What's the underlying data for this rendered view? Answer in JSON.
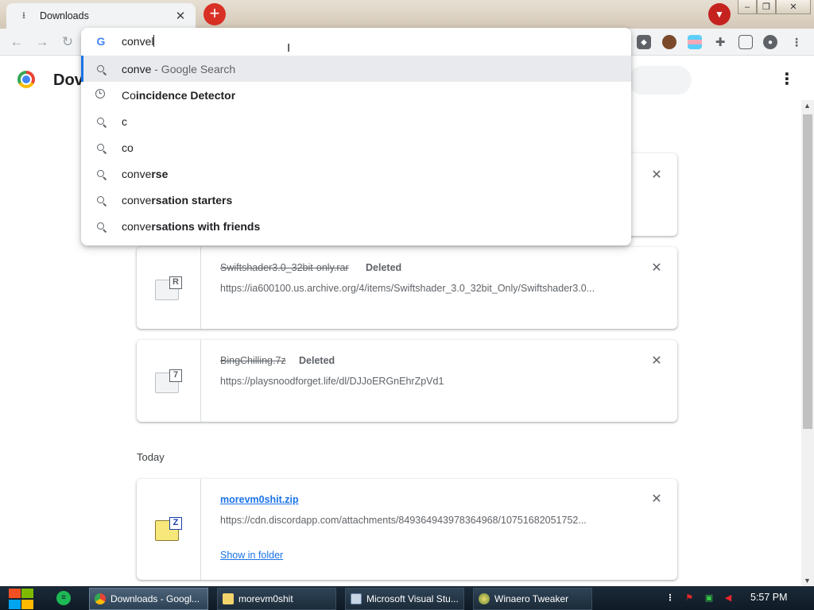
{
  "tab": {
    "title": "Downloads",
    "close_glyph": "✕",
    "icon": "download-icon"
  },
  "window_controls": {
    "minimize": "–",
    "maximize": "❐",
    "close": "✕"
  },
  "omnibox": {
    "input": "convel",
    "suggestions": [
      {
        "icon": "search-icon",
        "bold_prefix": "",
        "text": "conve",
        "suffix": " - Google Search",
        "selected": true
      },
      {
        "icon": "history-icon",
        "bold_prefix": "Co",
        "text": "incidence Detector",
        "suffix": "",
        "selected": false
      },
      {
        "icon": "search-icon",
        "bold_prefix": "",
        "text": "c",
        "suffix": "",
        "selected": false
      },
      {
        "icon": "search-icon",
        "bold_prefix": "",
        "text": "co",
        "suffix": "",
        "selected": false
      },
      {
        "icon": "search-icon",
        "bold_prefix": "conve",
        "text": "rse",
        "suffix": "",
        "selected": false
      },
      {
        "icon": "search-icon",
        "bold_prefix": "conve",
        "text": "rsation starters",
        "suffix": "",
        "selected": false
      },
      {
        "icon": "search-icon",
        "bold_prefix": "conve",
        "text": "rsations with friends",
        "suffix": "",
        "selected": false
      }
    ]
  },
  "page": {
    "title": "Dov",
    "section_today": "Today"
  },
  "downloads": [
    {
      "name": "Swiftshader3.0_32bit-only.rar",
      "status": "Deleted",
      "url": "https://ia600100.us.archive.org/4/items/Swiftshader_3.0_32bit_Only/Swiftshader3.0...",
      "badge": "R"
    },
    {
      "name": "BingChilling.7z",
      "status": "Deleted",
      "url": "https://playsnoodforget.life/dl/DJJoERGnEhrZpVd1",
      "badge": "7"
    },
    {
      "name": "morevm0shit.zip",
      "status": "",
      "url": "https://cdn.discordapp.com/attachments/849364943978364968/10751682051752...",
      "badge": "Z",
      "action": "Show in folder"
    }
  ],
  "taskbar": {
    "items": [
      {
        "label": "Downloads - Googl...",
        "icon": "chrome-icon",
        "active": true
      },
      {
        "label": "morevm0shit",
        "icon": "folder-icon",
        "active": false
      },
      {
        "label": "Microsoft Visual Stu...",
        "icon": "visual-studio-icon",
        "active": false
      },
      {
        "label": "Winaero Tweaker",
        "icon": "winaero-icon",
        "active": false
      }
    ],
    "clock": "5:57 PM"
  },
  "colors": {
    "accent": "#1a73e8",
    "new_tab": "#d93025",
    "taskbar": "#1b2a38"
  }
}
